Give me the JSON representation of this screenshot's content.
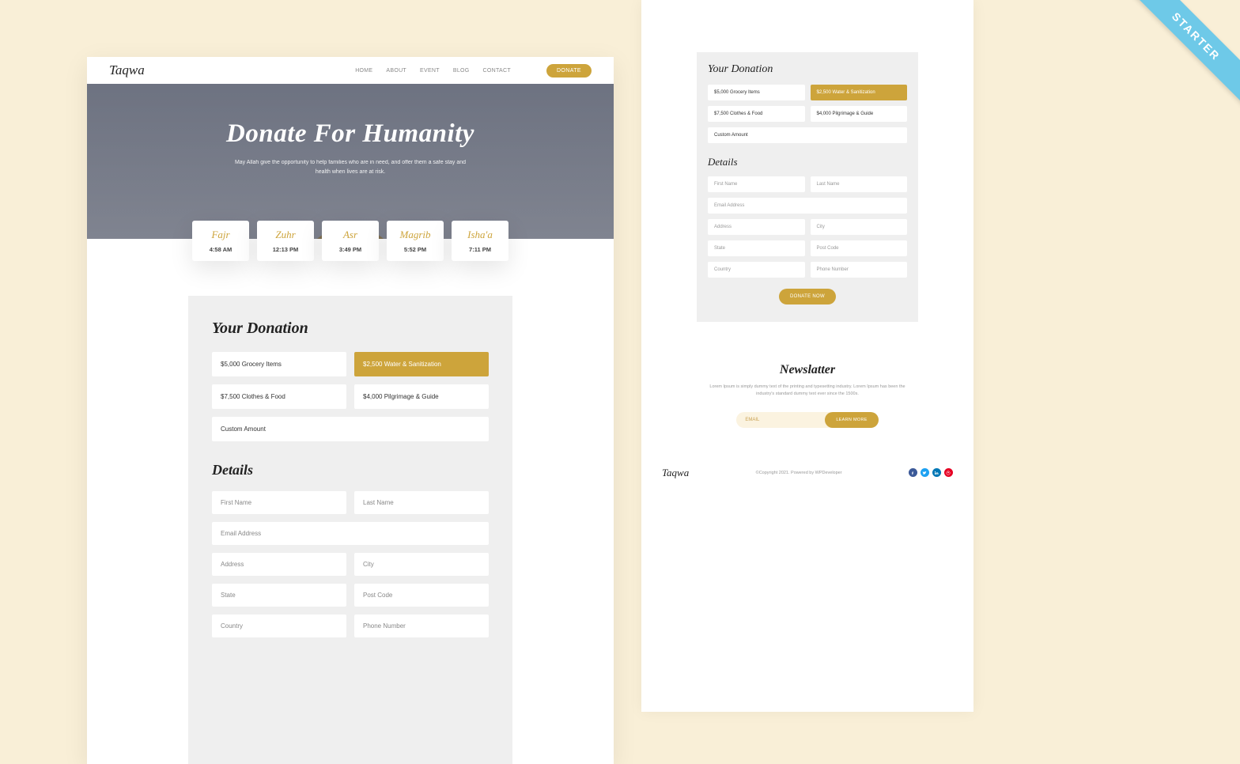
{
  "brand": "Taqwa",
  "ribbon": "STARTER",
  "nav": {
    "items": [
      "HOME",
      "ABOUT",
      "EVENT",
      "BLOG",
      "CONTACT"
    ],
    "cta": "DONATE"
  },
  "hero": {
    "title": "Donate For Humanity",
    "subtitle": "May Allah give the opportunity to help families who are in need, and offer them a safe stay and health when lives are at risk."
  },
  "prayers": [
    {
      "name": "Fajr",
      "time": "4:58 AM"
    },
    {
      "name": "Zuhr",
      "time": "12:13 PM"
    },
    {
      "name": "Asr",
      "time": "3:49 PM"
    },
    {
      "name": "Magrib",
      "time": "5:52 PM"
    },
    {
      "name": "Isha'a",
      "time": "7:11 PM"
    }
  ],
  "donation": {
    "heading": "Your Donation",
    "options": [
      {
        "label": "$5,000 Grocery Items",
        "active": false
      },
      {
        "label": "$2,500 Water & Sanitization",
        "active": true
      },
      {
        "label": "$7,500 Clothes & Food",
        "active": false
      },
      {
        "label": "$4,000 Pilgrimage & Guide",
        "active": false
      }
    ],
    "custom": "Custom Amount",
    "details_heading": "Details",
    "fields": {
      "first": "First Name",
      "last": "Last Name",
      "email": "Email Address",
      "address": "Address",
      "city": "City",
      "state": "State",
      "post": "Post Code",
      "country": "Country",
      "phone": "Phone Number"
    },
    "submit": "DONATE NOW"
  },
  "newsletter": {
    "heading": "Newslatter",
    "text": "Lorem Ipsum is simply dummy text of the printing and typesetting industry. Lorem Ipsum has been the industry's standard dummy text ever since the 1500s.",
    "placeholder": "EMAIL",
    "cta": "LEARN MORE"
  },
  "footer": {
    "copyright": "©Copyright 2021. Powered by WPDeveloper"
  },
  "colors": {
    "accent": "#cda43b",
    "fb": "#3b5998",
    "tw": "#1da1f2",
    "in": "#0077b5",
    "pin": "#e60023"
  }
}
